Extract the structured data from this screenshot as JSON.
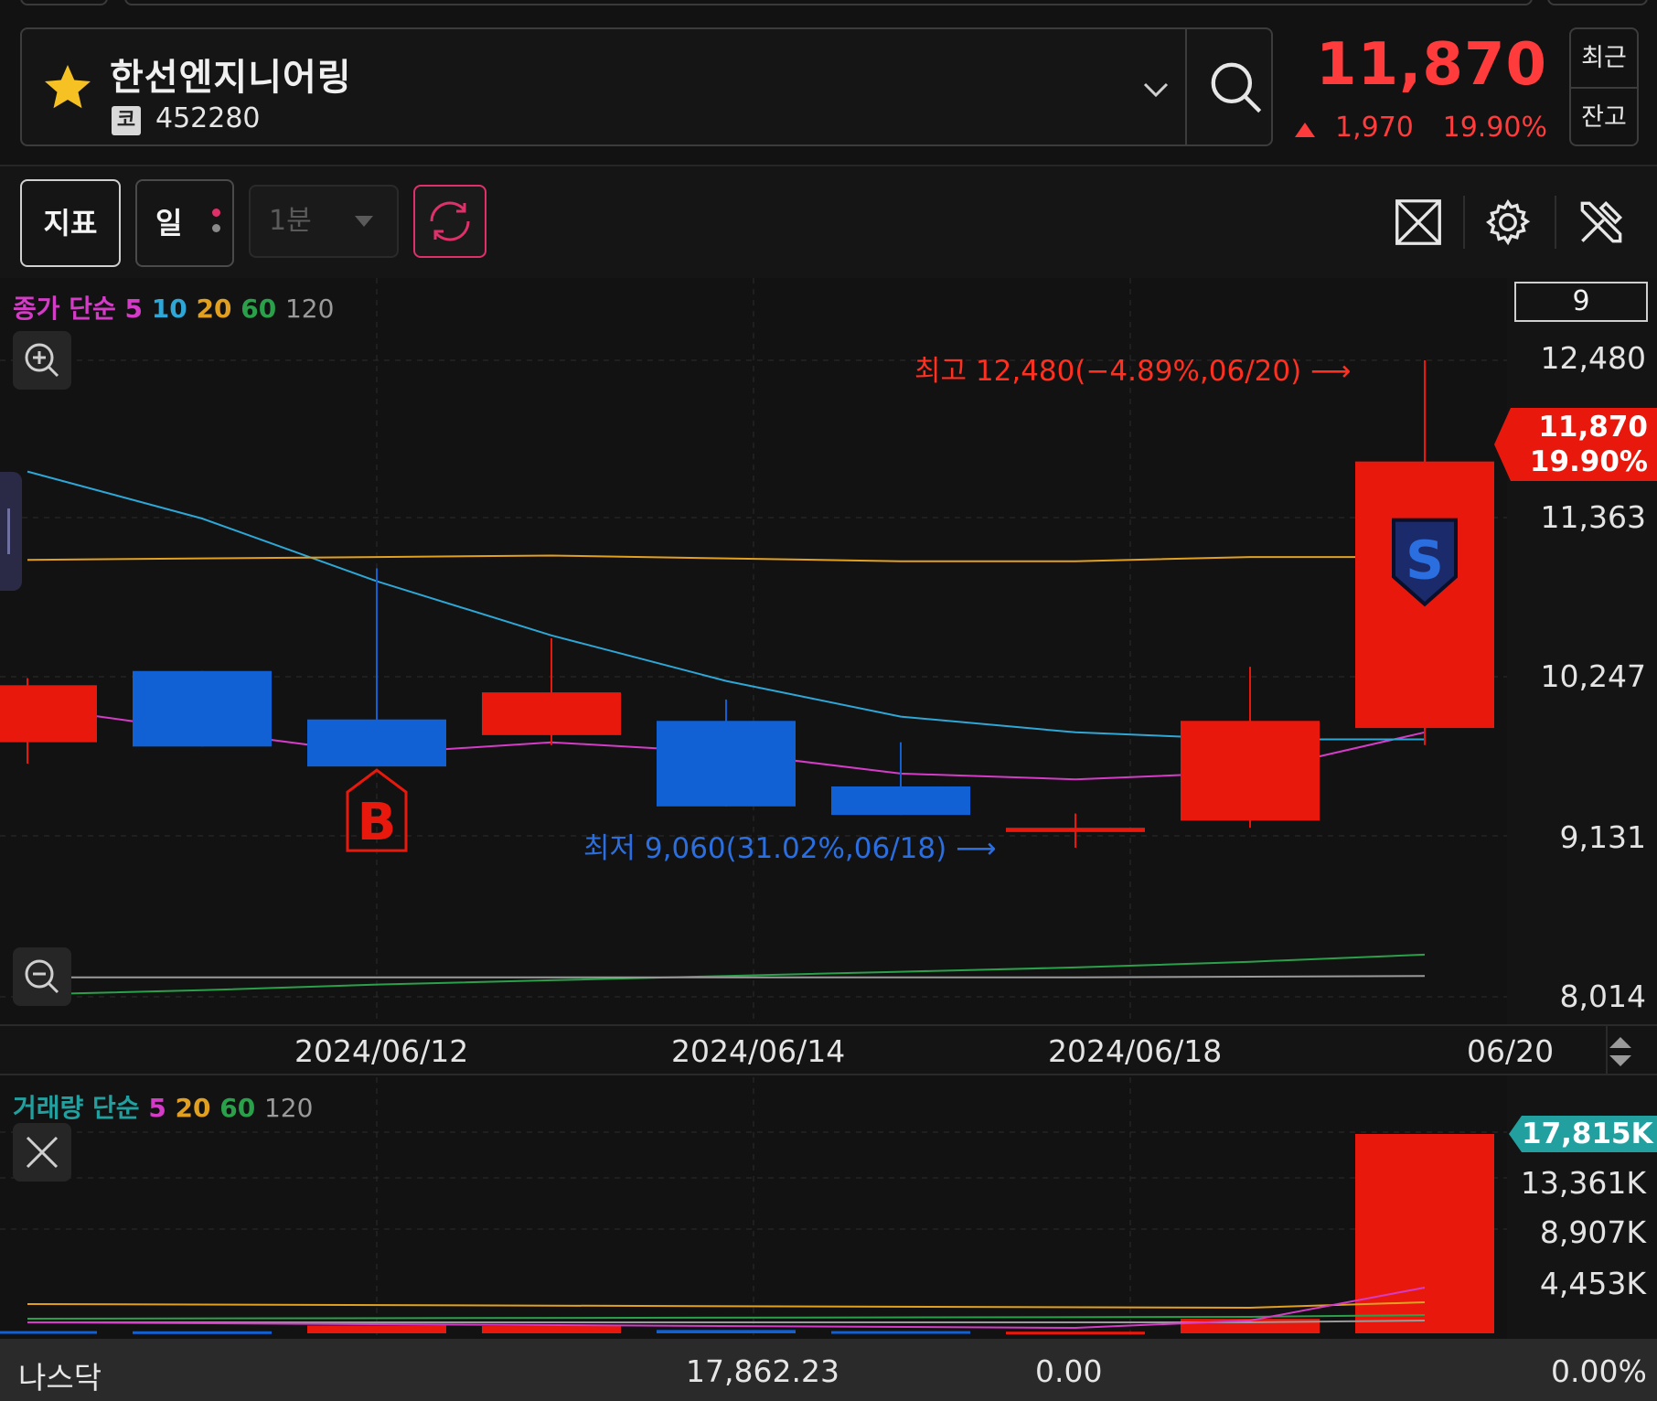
{
  "stock": {
    "name": "한선엔지니어링",
    "market_badge": "코",
    "code": "452280",
    "price": "11,870",
    "change": "1,970",
    "rate": "19.90%"
  },
  "side_buttons": {
    "recent": "최근",
    "balance": "잔고"
  },
  "toolbar": {
    "indicator_label": "지표",
    "period_label": "일",
    "minute_label": "1분"
  },
  "chart": {
    "ma_legend": {
      "prefix": "종가 단순",
      "p1": "5",
      "p2": "10",
      "p3": "20",
      "p4": "60",
      "p5": "120"
    },
    "scale_value": "9",
    "current_price_tag": "11,870",
    "current_rate_tag": "19.90%",
    "high_annotation": "최고 12,480(−4.89%,06/20) ⟶",
    "low_annotation": "최저 9,060(31.02%,06/18) ⟶",
    "buy_signal": "B",
    "sell_signal": "S",
    "colors": {
      "up": "#e8190c",
      "down": "#1160d4",
      "ma5": "#d43cc8",
      "ma10": "#2ea7d6",
      "ma20": "#e2a020",
      "ma60": "#2aa04a",
      "ma120": "#9a9a9a"
    }
  },
  "chart_data": {
    "type": "candlestick",
    "y_ticks": [
      "12,480",
      "11,363",
      "10,247",
      "9,131",
      "8,014"
    ],
    "x_ticks": [
      "2024/06/12",
      "2024/06/14",
      "2024/06/18",
      "06/20"
    ],
    "ylim": [
      8014,
      12480
    ],
    "candles": [
      {
        "open": 9800,
        "close": 10200,
        "high": 10250,
        "low": 9650,
        "dir": "up"
      },
      {
        "open": 10300,
        "close": 9770,
        "high": 10300,
        "low": 9770,
        "dir": "down"
      },
      {
        "open": 9960,
        "close": 9630,
        "high": 11020,
        "low": 9630,
        "dir": "down"
      },
      {
        "open": 9850,
        "close": 10150,
        "high": 10530,
        "low": 9780,
        "dir": "up"
      },
      {
        "open": 9950,
        "close": 9350,
        "high": 10100,
        "low": 9350,
        "dir": "down"
      },
      {
        "open": 9490,
        "close": 9290,
        "high": 9800,
        "low": 9290,
        "dir": "down"
      },
      {
        "open": 9170,
        "close": 9200,
        "high": 9300,
        "low": 9060,
        "dir": "up"
      },
      {
        "open": 9250,
        "close": 9950,
        "high": 10330,
        "low": 9200,
        "dir": "up"
      },
      {
        "open": 9900,
        "close": 11770,
        "high": 12480,
        "low": 9780,
        "dir": "up"
      }
    ],
    "series": [
      {
        "name": "5",
        "values": [
          10050,
          9880,
          9720,
          9800,
          9730,
          9580,
          9540,
          9590,
          9870
        ]
      },
      {
        "name": "10",
        "values": [
          11700,
          11370,
          10930,
          10550,
          10230,
          9980,
          9870,
          9820,
          9820
        ]
      },
      {
        "name": "20",
        "values": [
          11080,
          11090,
          11100,
          11110,
          11090,
          11070,
          11070,
          11100,
          11100
        ]
      },
      {
        "name": "60",
        "values": [
          8030,
          8060,
          8100,
          8130,
          8160,
          8190,
          8220,
          8260,
          8310
        ]
      },
      {
        "name": "120",
        "values": [
          8150,
          8150,
          8150,
          8150,
          8150,
          8150,
          8150,
          8155,
          8160
        ]
      }
    ]
  },
  "volume": {
    "legend": {
      "prefix": "거래량 단순",
      "p1": "5",
      "p2": "20",
      "p3": "60",
      "p4": "120"
    },
    "current_tag": "17,815K",
    "ticks": [
      "13,361K",
      "8,907K",
      "4,453K"
    ]
  },
  "volume_data": {
    "ylim": [
      0,
      17815
    ],
    "values": [
      {
        "v": 200,
        "dir": "down"
      },
      {
        "v": 180,
        "dir": "down"
      },
      {
        "v": 700,
        "dir": "up"
      },
      {
        "v": 650,
        "dir": "up"
      },
      {
        "v": 300,
        "dir": "down"
      },
      {
        "v": 200,
        "dir": "down"
      },
      {
        "v": 150,
        "dir": "up"
      },
      {
        "v": 1300,
        "dir": "up"
      },
      {
        "v": 17815,
        "dir": "up"
      }
    ]
  },
  "bottom_bar": {
    "index_name": "나스닥",
    "index_value": "17,862.23",
    "index_change": "0.00",
    "index_rate": "0.00%"
  }
}
